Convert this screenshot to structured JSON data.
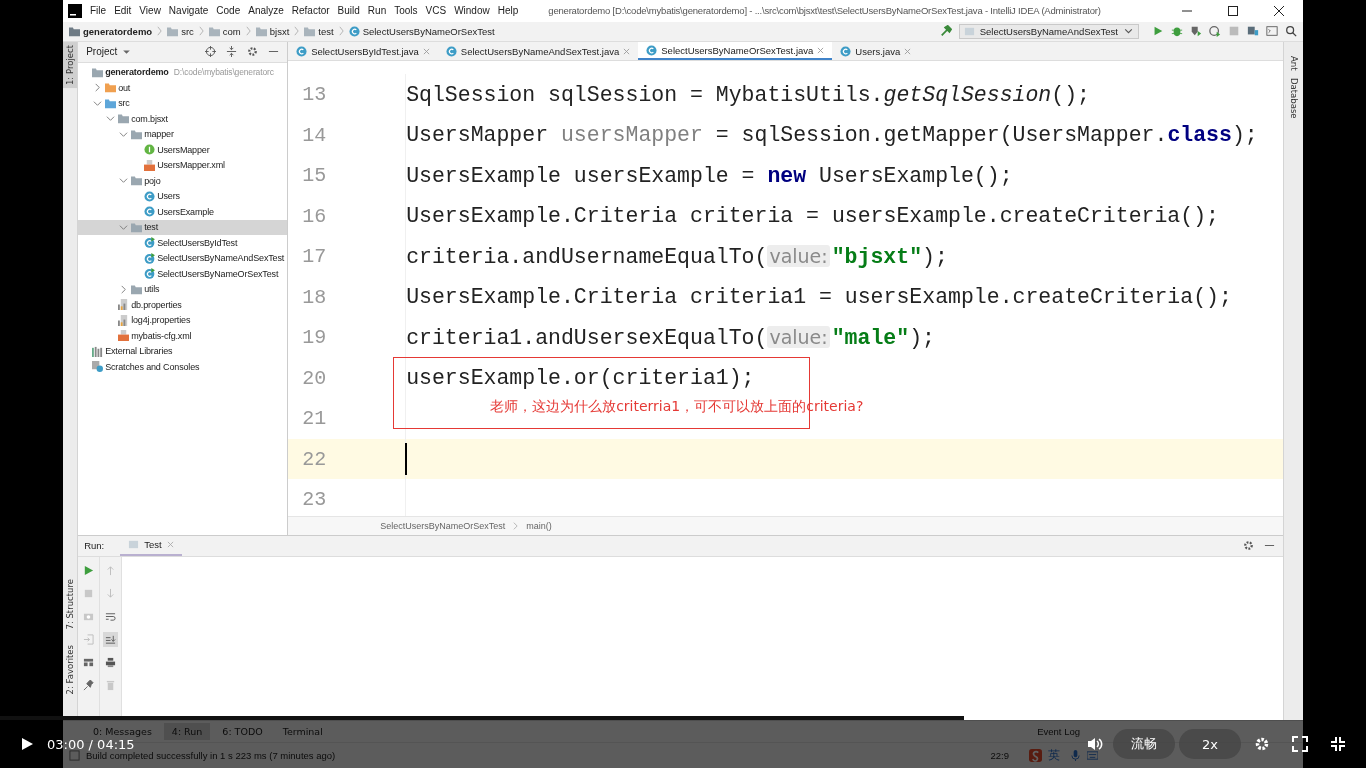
{
  "menu": [
    "File",
    "Edit",
    "View",
    "Navigate",
    "Code",
    "Analyze",
    "Refactor",
    "Build",
    "Run",
    "Tools",
    "VCS",
    "Window",
    "Help"
  ],
  "window_title": "generatordemo [D:\\code\\mybatis\\generatordemo] - ...\\src\\com\\bjsxt\\test\\SelectUsersByNameOrSexTest.java - IntelliJ IDEA (Administrator)",
  "breadcrumbs": [
    {
      "label": "generatordemo",
      "kind": "project"
    },
    {
      "label": "src",
      "kind": "folder"
    },
    {
      "label": "com",
      "kind": "folder"
    },
    {
      "label": "bjsxt",
      "kind": "folder"
    },
    {
      "label": "test",
      "kind": "folder"
    },
    {
      "label": "SelectUsersByNameOrSexTest",
      "kind": "class"
    }
  ],
  "run_config": "SelectUsersByNameAndSexTest",
  "side_tools": {
    "left": [
      {
        "label": "1: Project",
        "selected": true
      },
      {
        "label": "7: Structure",
        "selected": false
      },
      {
        "label": "2: Favorites",
        "selected": false
      }
    ],
    "right": [
      "Ant",
      "Database"
    ]
  },
  "project_panel": {
    "title": "Project",
    "tree": [
      {
        "label": "generatordemo",
        "path": "D:\\code\\mybatis\\generatorc",
        "kind": "module",
        "selected": false,
        "children": [
          {
            "label": "out",
            "kind": "excluded",
            "expanded": false,
            "selected": false
          },
          {
            "label": "src",
            "kind": "source",
            "expanded": true,
            "selected": false,
            "children": [
              {
                "label": "com.bjsxt",
                "kind": "package",
                "expanded": true,
                "selected": false,
                "children": [
                  {
                    "label": "mapper",
                    "kind": "package",
                    "expanded": true,
                    "selected": false,
                    "children": [
                      {
                        "label": "UsersMapper",
                        "kind": "interface",
                        "selected": false
                      },
                      {
                        "label": "UsersMapper.xml",
                        "kind": "xml",
                        "selected": false
                      }
                    ]
                  },
                  {
                    "label": "pojo",
                    "kind": "package",
                    "expanded": true,
                    "selected": false,
                    "children": [
                      {
                        "label": "Users",
                        "kind": "class",
                        "selected": false
                      },
                      {
                        "label": "UsersExample",
                        "kind": "class",
                        "selected": false
                      }
                    ]
                  },
                  {
                    "label": "test",
                    "kind": "package",
                    "expanded": true,
                    "selected": true,
                    "children": [
                      {
                        "label": "SelectUsersByIdTest",
                        "kind": "test",
                        "selected": false
                      },
                      {
                        "label": "SelectUsersByNameAndSexTest",
                        "kind": "test",
                        "selected": false
                      },
                      {
                        "label": "SelectUsersByNameOrSexTest",
                        "kind": "test",
                        "selected": false
                      }
                    ]
                  },
                  {
                    "label": "utils",
                    "kind": "package",
                    "expanded": false,
                    "selected": false
                  }
                ]
              },
              {
                "label": "db.properties",
                "kind": "properties",
                "selected": false
              },
              {
                "label": "log4j.properties",
                "kind": "properties",
                "selected": false
              },
              {
                "label": "mybatis-cfg.xml",
                "kind": "xml",
                "selected": false
              }
            ]
          }
        ]
      },
      {
        "label": "External Libraries",
        "kind": "libraries",
        "selected": false
      },
      {
        "label": "Scratches and Consoles",
        "kind": "scratches",
        "selected": false
      }
    ]
  },
  "editor_tabs": [
    {
      "label": "SelectUsersByIdTest.java",
      "selected": false
    },
    {
      "label": "SelectUsersByNameAndSexTest.java",
      "selected": false
    },
    {
      "label": "SelectUsersByNameOrSexTest.java",
      "selected": true
    },
    {
      "label": "Users.java",
      "selected": false
    }
  ],
  "code_lines": [
    {
      "number": "13",
      "current": false,
      "tokens": [
        {
          "text": "SqlSession sqlSession = MybatisUtils.",
          "kind": "plain"
        },
        {
          "text": "getSqlSession",
          "kind": "static"
        },
        {
          "text": "();",
          "kind": "plain"
        }
      ]
    },
    {
      "number": "14",
      "current": false,
      "tokens": [
        {
          "text": "UsersMapper ",
          "kind": "plain"
        },
        {
          "text": "usersMapper",
          "kind": "unused"
        },
        {
          "text": " = sqlSession.getMapper(UsersMapper.",
          "kind": "plain"
        },
        {
          "text": "class",
          "kind": "keyword"
        },
        {
          "text": ");",
          "kind": "plain"
        }
      ]
    },
    {
      "number": "15",
      "current": false,
      "tokens": [
        {
          "text": "UsersExample usersExample = ",
          "kind": "plain"
        },
        {
          "text": "new",
          "kind": "keyword"
        },
        {
          "text": " UsersExample();",
          "kind": "plain"
        }
      ]
    },
    {
      "number": "16",
      "current": false,
      "tokens": [
        {
          "text": "UsersExample.Criteria criteria = usersExample.createCriteria();",
          "kind": "plain"
        }
      ]
    },
    {
      "number": "17",
      "current": false,
      "tokens": [
        {
          "text": "criteria.andUsernameEqualTo(",
          "kind": "plain"
        },
        {
          "text": "value:",
          "kind": "hint"
        },
        {
          "text": "\"bjsxt\"",
          "kind": "string"
        },
        {
          "text": ");",
          "kind": "plain"
        }
      ]
    },
    {
      "number": "18",
      "current": false,
      "tokens": [
        {
          "text": "UsersExample.Criteria criteria1 = usersExample.createCriteria();",
          "kind": "plain"
        }
      ]
    },
    {
      "number": "19",
      "current": false,
      "tokens": [
        {
          "text": "criteria1.andUsersexEqualTo(",
          "kind": "plain"
        },
        {
          "text": "value:",
          "kind": "hint"
        },
        {
          "text": "\"male\"",
          "kind": "string"
        },
        {
          "text": ");",
          "kind": "plain"
        }
      ]
    },
    {
      "number": "20",
      "current": false,
      "tokens": [
        {
          "text": "usersExample.or(criteria1);",
          "kind": "plain"
        }
      ]
    },
    {
      "number": "21",
      "current": false
    },
    {
      "number": "22",
      "current": true
    },
    {
      "number": "23",
      "current": false
    }
  ],
  "annotation": "老师，这边为什么放criterria1，可不可以放上面的criteria?",
  "editor_breadcrumbs": [
    "SelectUsersByNameOrSexTest",
    "main()"
  ],
  "run_panel": {
    "label": "Run:",
    "tabs": [
      {
        "label": "Test",
        "selected": true
      }
    ]
  },
  "tool_windows": [
    {
      "label": "0: Messages",
      "selected": false
    },
    {
      "label": "4: Run",
      "selected": true
    },
    {
      "label": "6: TODO",
      "selected": false
    },
    {
      "label": "Terminal",
      "selected": false
    }
  ],
  "event_log": "Event Log",
  "status": {
    "message": "Build completed successfully in 1 s 223 ms (7 minutes ago)",
    "position": "22:9"
  },
  "ime": "英",
  "player": {
    "time": "03:00 / 04:15",
    "level": 0.706,
    "quality": "流畅",
    "speed": "2x"
  }
}
